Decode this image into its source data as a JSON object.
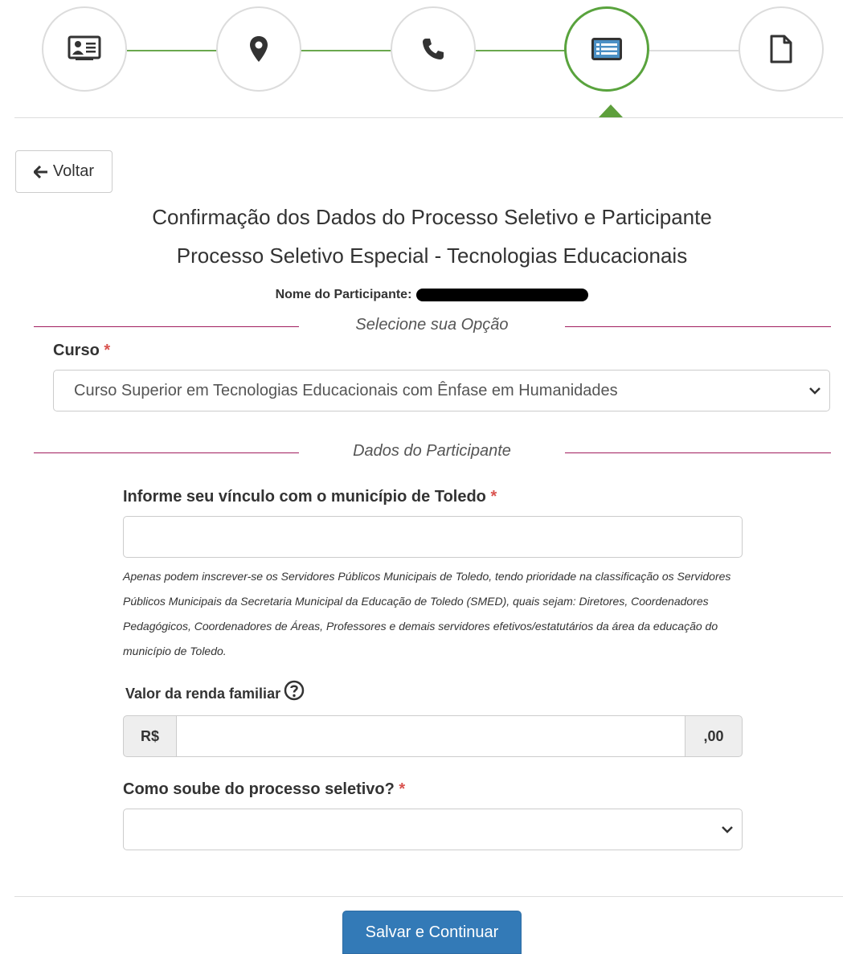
{
  "stepper": {
    "steps": [
      {
        "icon": "id-card-icon",
        "state": "done"
      },
      {
        "icon": "map-marker-icon",
        "state": "done"
      },
      {
        "icon": "phone-icon",
        "state": "done"
      },
      {
        "icon": "list-icon",
        "state": "active"
      },
      {
        "icon": "file-icon",
        "state": "pending"
      }
    ],
    "colors": {
      "done": "#59a33d",
      "pending": "#dcdcdc"
    }
  },
  "back_button": {
    "label": "Voltar",
    "icon": "arrow-left-icon"
  },
  "header": {
    "title": "Confirmação dos Dados do Processo Seletivo e Participante",
    "subtitle": "Processo Seletivo Especial - Tecnologias Educacionais",
    "participant_label": "Nome do Participante:"
  },
  "section_option": {
    "title": "Selecione sua Opção",
    "course_label": "Curso",
    "required_mark": "*",
    "course_value": "Curso Superior em Tecnologias Educacionais com Ênfase em Humanidades"
  },
  "section_participant": {
    "title": "Dados do Participante",
    "vinculo_label": "Informe seu vínculo com o município de Toledo",
    "required_mark": "*",
    "vinculo_value": "",
    "vinculo_help": "Apenas podem inscrever-se os Servidores Públicos Municipais de Toledo, tendo prioridade na classificação os Servidores Públicos Municipais da Secretaria Municipal da Educação de Toledo (SMED), quais sejam: Diretores, Coordenadores Pedagógicos, Coordenadores de Áreas, Professores e demais servidores efetivos/estatutários da área da educação do município de Toledo.",
    "renda_label": "Valor da renda familiar",
    "renda_help_icon": "question-circle-icon",
    "renda_prefix": "R$",
    "renda_value": "",
    "renda_suffix": ",00",
    "como_soube_label": "Como soube do processo seletivo?",
    "como_soube_value": ""
  },
  "save_button": {
    "label": "Salvar e Continuar"
  },
  "colors": {
    "accent_green": "#59a33d",
    "separator": "#a11d5e",
    "primary": "#337ab7",
    "required": "#d9534f"
  }
}
